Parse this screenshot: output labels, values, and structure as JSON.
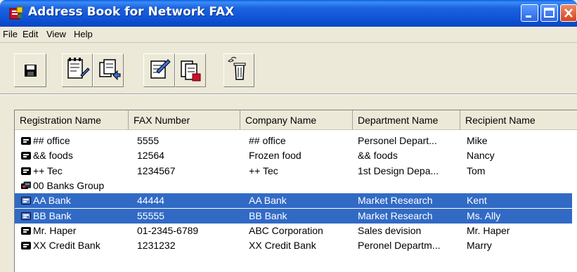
{
  "window": {
    "title": "Address Book for Network FAX"
  },
  "menu": {
    "items": [
      "File",
      "Edit",
      "View",
      "Help"
    ]
  },
  "toolbar": {
    "buttons": [
      {
        "icon": "save-icon"
      },
      {
        "icon": "new-entry-icon"
      },
      {
        "icon": "new-group-icon"
      },
      {
        "icon": "edit-icon"
      },
      {
        "icon": "address-book-icon"
      },
      {
        "icon": "delete-icon"
      }
    ]
  },
  "list": {
    "columns": [
      "Registration Name",
      "FAX Number",
      "Company Name",
      "Department Name",
      "Recipient Name"
    ],
    "rows": [
      {
        "type": "person",
        "selected": false,
        "cells": [
          "## office",
          "5555",
          "## office",
          "Personel Depart...",
          "Mike"
        ]
      },
      {
        "type": "person",
        "selected": false,
        "cells": [
          "&& foods",
          "12564",
          "Frozen food",
          "&& foods",
          "Nancy"
        ]
      },
      {
        "type": "person",
        "selected": false,
        "cells": [
          "++ Tec",
          "1234567",
          "++ Tec",
          "1st Design Depa...",
          "Tom"
        ]
      },
      {
        "type": "group",
        "selected": false,
        "cells": [
          "00 Banks Group",
          "",
          "",
          "",
          ""
        ]
      },
      {
        "type": "person",
        "selected": true,
        "cells": [
          "AA Bank",
          "44444",
          "AA Bank",
          "Market Research",
          "Kent"
        ]
      },
      {
        "type": "person",
        "selected": true,
        "cells": [
          "BB Bank",
          "55555",
          "BB Bank",
          "Market Research",
          "Ms. Ally"
        ]
      },
      {
        "type": "person",
        "selected": false,
        "cells": [
          "Mr. Haper",
          "01-2345-6789",
          "ABC Corporation",
          "Sales devision",
          "Mr. Haper"
        ]
      },
      {
        "type": "person",
        "selected": false,
        "cells": [
          "XX Credit Bank",
          "1231232",
          "XX Credit Bank",
          "Peronel Departm...",
          "Marry"
        ]
      }
    ]
  },
  "colors": {
    "titlebar": "#0f53d6",
    "selection": "#316ac5",
    "close_button": "#d4431d"
  }
}
